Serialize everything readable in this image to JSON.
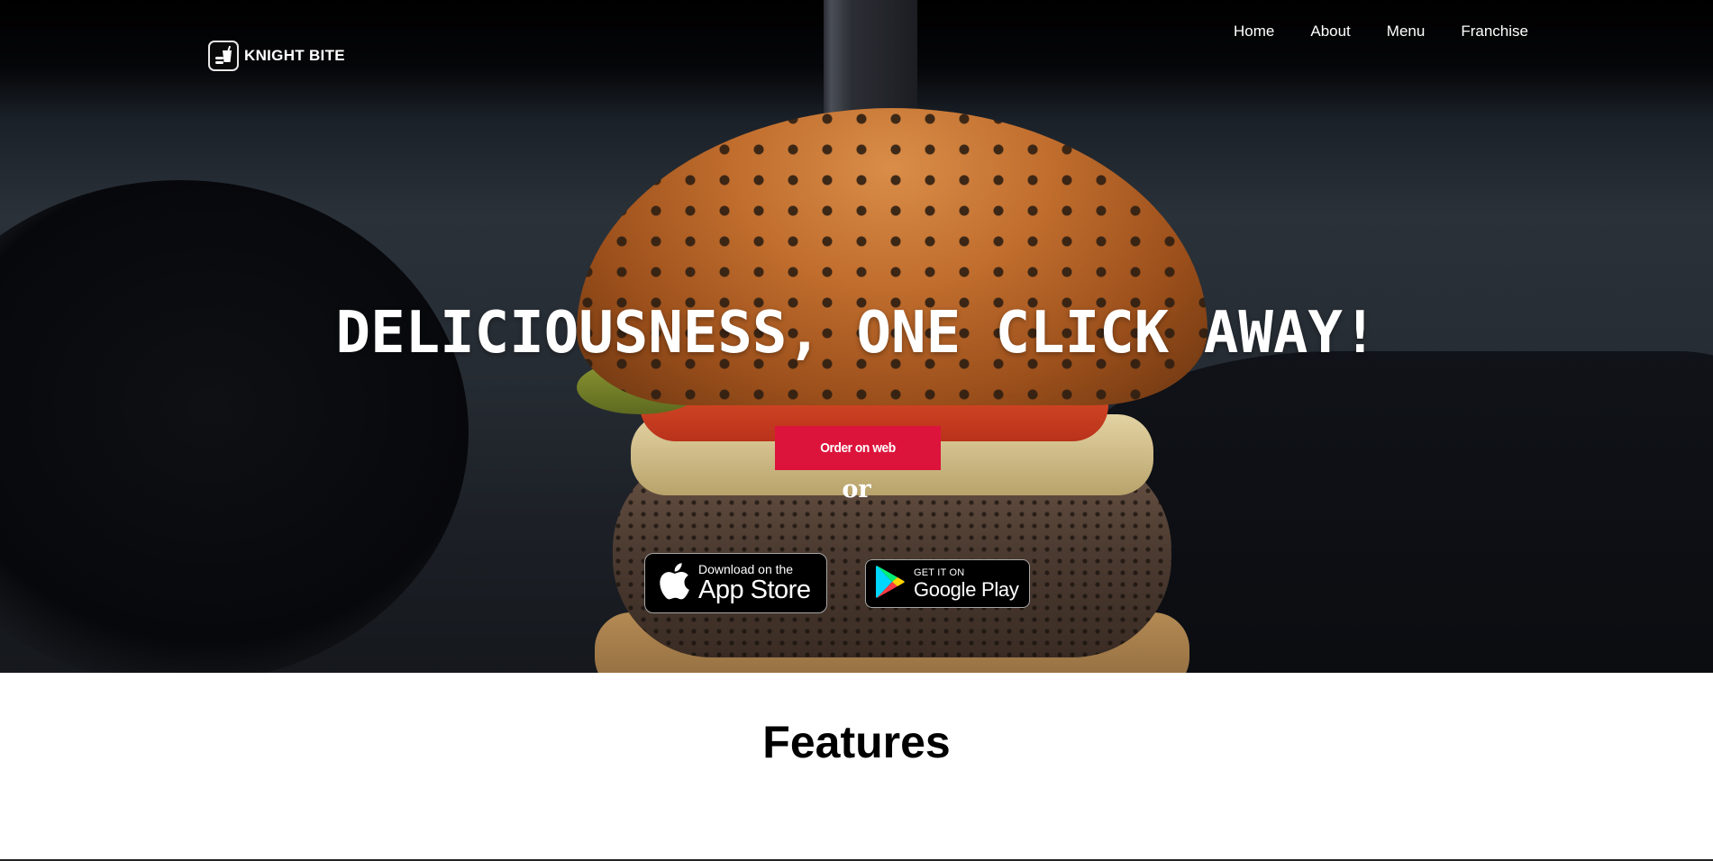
{
  "brand": {
    "name": "KNIGHT BITE",
    "logo_icon": "knight-bite-logo-icon"
  },
  "nav": {
    "items": [
      {
        "label": "Home"
      },
      {
        "label": "About"
      },
      {
        "label": "Menu"
      },
      {
        "label": "Franchise"
      }
    ]
  },
  "hero": {
    "headline": "DELICIOUSNESS, ONE CLICK AWAY!",
    "order_button": "Order on web",
    "separator": "or",
    "app_store": {
      "small": "Download on the",
      "big": "App Store",
      "icon": "apple-icon"
    },
    "google_play": {
      "small": "GET IT ON",
      "big": "Google Play",
      "icon": "google-play-icon"
    }
  },
  "features": {
    "title": "Features"
  },
  "colors": {
    "accent": "#dc143c",
    "hero_text": "#ffffff",
    "nav_text": "#ffffff"
  }
}
